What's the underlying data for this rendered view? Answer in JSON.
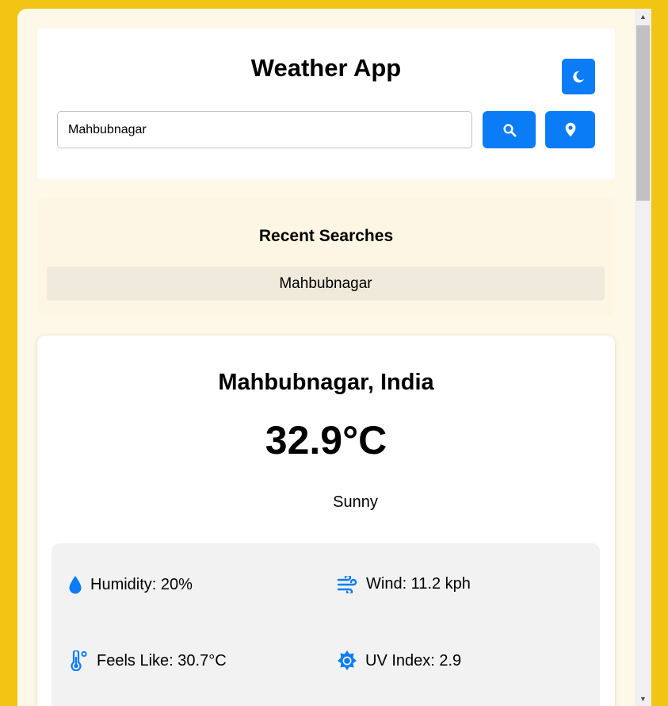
{
  "header": {
    "title": "Weather App",
    "theme_toggle_icon": "moon-icon",
    "search": {
      "value": "Mahbubnagar",
      "placeholder": ""
    },
    "search_icon": "search-icon",
    "location_icon": "map-pin-icon"
  },
  "recent": {
    "title": "Recent Searches",
    "items": [
      "Mahbubnagar"
    ]
  },
  "weather": {
    "location": "Mahbubnagar, India",
    "temperature": "32.9°C",
    "condition": "Sunny",
    "details": {
      "humidity": "Humidity: 20%",
      "wind": "Wind: 11.2 kph",
      "feels_like": "Feels Like: 30.7°C",
      "uv_index": "UV Index: 2.9"
    }
  },
  "colors": {
    "page_background": "#f2c514",
    "accent": "#0a7cf5",
    "panel_background": "#fdf8e8"
  }
}
